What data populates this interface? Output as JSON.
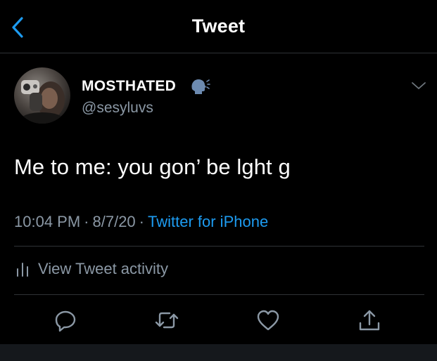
{
  "header": {
    "title": "Tweet",
    "back_icon": "chevron-left-icon"
  },
  "tweet": {
    "author": {
      "display_name": "MOSTHATED",
      "name_emoji": "speaking-head-icon",
      "handle": "@sesyluvs"
    },
    "text": "Me to me: you gon’ be lght g",
    "time": "10:04 PM",
    "separator": "·",
    "date": "8/7/20",
    "source": "Twitter for iPhone",
    "activity_label": "View Tweet activity"
  },
  "actions": [
    "reply-icon",
    "retweet-icon",
    "like-icon",
    "share-icon"
  ],
  "colors": {
    "background": "#000000",
    "text": "#ffffff",
    "secondary": "#8b98a5",
    "accent": "#1d9bf0",
    "divider": "#2f3336"
  }
}
